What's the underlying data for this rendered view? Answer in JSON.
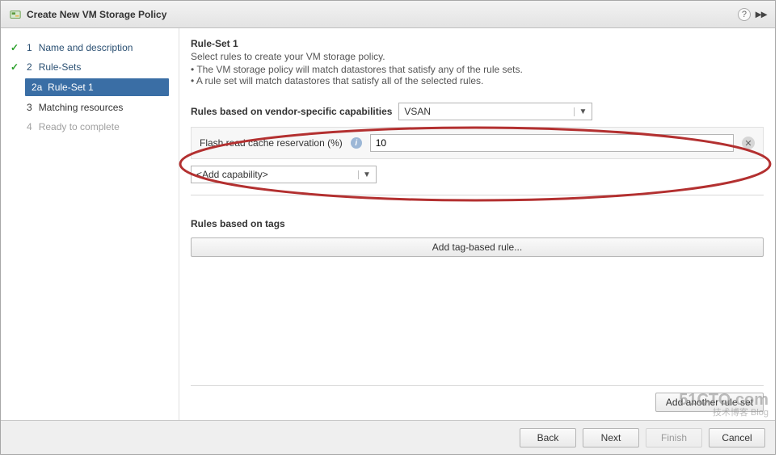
{
  "title": "Create New VM Storage Policy",
  "sidebar": {
    "steps": [
      {
        "num": "1",
        "label": "Name and description",
        "state": "completed"
      },
      {
        "num": "2",
        "label": "Rule-Sets",
        "state": "completed"
      },
      {
        "num": "3",
        "label": "Matching resources",
        "state": "pending"
      },
      {
        "num": "4",
        "label": "Ready to complete",
        "state": "disabled"
      }
    ],
    "substep": {
      "num": "2a",
      "label": "Rule-Set 1"
    }
  },
  "main": {
    "heading": "Rule-Set 1",
    "desc": "Select rules to create your VM storage policy.",
    "bullets": [
      "The VM storage policy will match datastores that satisfy any of the rule sets.",
      "A rule set will match datastores that satisfy all of the selected rules."
    ],
    "vendor_section": {
      "title": "Rules based on vendor-specific capabilities",
      "dropdown_value": "VSAN",
      "row": {
        "label": "Flash read cache reservation (%)",
        "value": "10"
      },
      "add_capability": "<Add capability>"
    },
    "tags_section": {
      "title": "Rules based on tags",
      "button": "Add tag-based rule..."
    },
    "add_ruleset": "Add another rule set"
  },
  "footer": {
    "back": "Back",
    "next": "Next",
    "finish": "Finish",
    "cancel": "Cancel"
  },
  "watermark": {
    "main": "51CTO.com",
    "sub": "技术博客  Blog"
  }
}
